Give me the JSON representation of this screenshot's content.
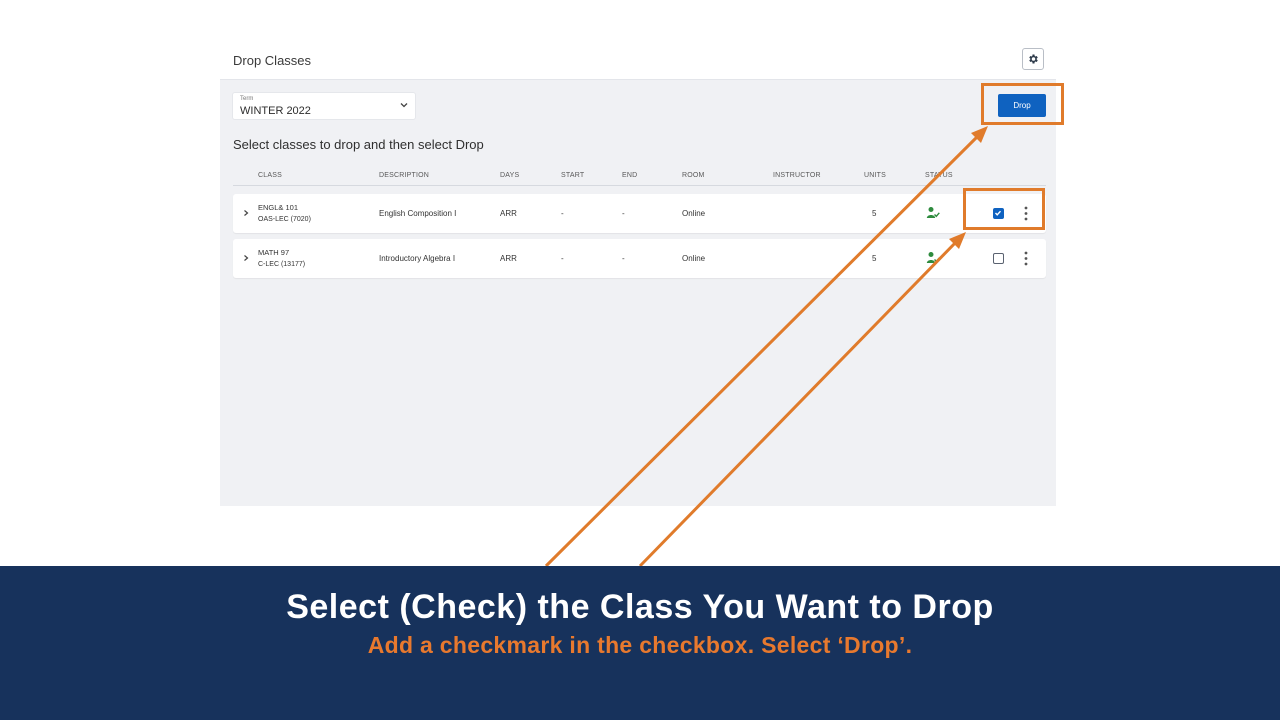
{
  "page": {
    "title": "Drop Classes",
    "term_label": "Term",
    "term_value": "WINTER 2022",
    "drop_label": "Drop",
    "instruction": "Select classes to drop and then select Drop"
  },
  "table": {
    "headers": [
      "CLASS",
      "DESCRIPTION",
      "DAYS",
      "START",
      "END",
      "ROOM",
      "INSTRUCTOR",
      "UNITS",
      "STATUS"
    ],
    "rows": [
      {
        "code": "ENGL& 101",
        "section": "OAS-LEC (7020)",
        "description": "English Composition I",
        "days": "ARR",
        "start": "-",
        "end": "-",
        "room": "Online",
        "instructor": "",
        "units": "5",
        "checked": true
      },
      {
        "code": "MATH 97",
        "section": "C-LEC (13177)",
        "description": "Introductory Algebra I",
        "days": "ARR",
        "start": "-",
        "end": "-",
        "room": "Online",
        "instructor": "",
        "units": "5",
        "checked": false
      }
    ]
  },
  "banner": {
    "title": "Select (Check) the Class You Want to Drop",
    "subtitle": "Add a checkmark in the checkbox. Select ‘Drop’."
  },
  "icons": {
    "settings": "gear-icon",
    "term_dropdown": "chevron-down-icon",
    "row_expand": "chevron-right-icon",
    "status": "enrolled-status-icon",
    "row_menu": "more-vertical-icon"
  },
  "colors": {
    "accent": "#0f62c0",
    "highlight": "#e07b2b",
    "banner_bg": "#17325c",
    "banner_sub": "#e8792e",
    "status_green": "#2e8b3e"
  }
}
